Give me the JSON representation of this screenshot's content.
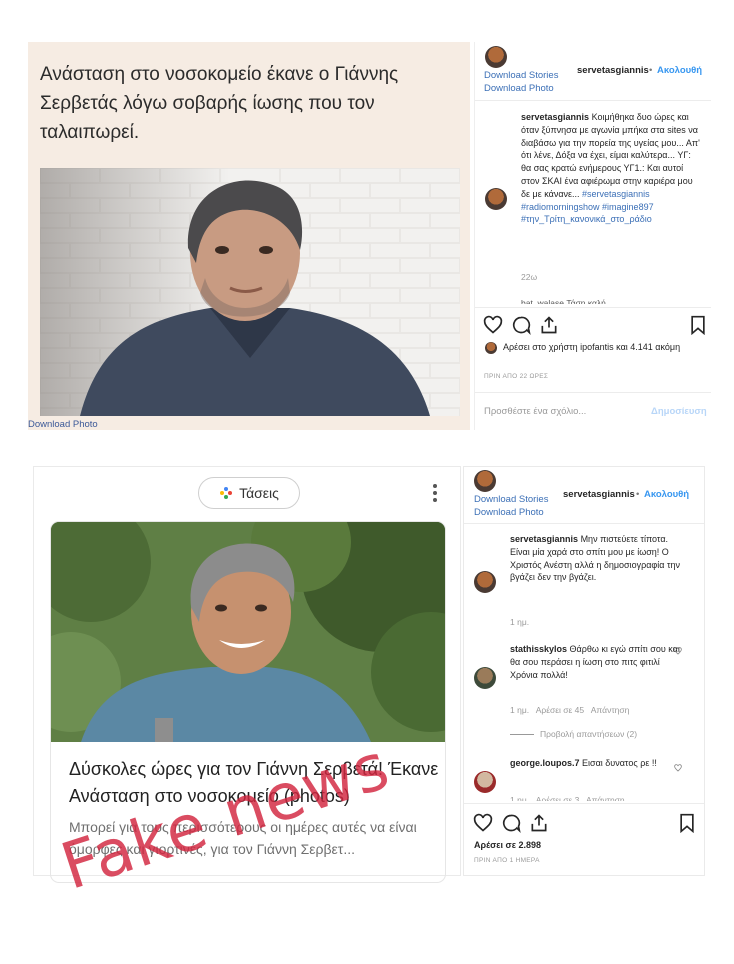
{
  "top": {
    "headline": "Ανάσταση στο νοσοκομείο έκανε ο Γιάννης Σερβετάς λόγω σοβαρής ίωσης που τον ταλαιπωρεί.",
    "download_photo_label": "Download Photo",
    "instagram": {
      "download_stories": "Download Stories",
      "download_photo": "Download Photo",
      "username": "servetasgiannis",
      "follow_sep": "•",
      "follow": "Ακολουθή",
      "caption_user": "servetasgiannis",
      "caption_text": "Κοιμήθηκα δυο ώρες και όταν ξύπνησα με αγωνία μπήκα στα sites να διαβάσω για την πορεία της υγείας μου... Απ' ότι λένε, Δόξα να έχει, είμαι καλύτερα... ΥΓ: θα σας κρατώ ενήμερους ΥΓ1.: Και αυτοί στον ΣΚΑΙ ένα αφιέρωμα στην καριέρα μου δε με κάνανε...",
      "hashtags": "#servetasgiannis #radiomorningshow #imagine897 #την_Τρίτη_κανονικά_στο_ράδιο",
      "caption_age": "22ω",
      "truncated_next": "bat_walase Τάση καλή",
      "liked_by": "Αρέσει στο χρήστη ipofantis και 4.141 ακόμη",
      "time_label": "ΠΡΙΝ ΑΠΟ 22 ΩΡΕΣ",
      "comment_placeholder": "Προσθέστε ένα σχόλιο...",
      "post_button": "Δημοσίευση"
    }
  },
  "bottom": {
    "trends_label": "Τάσεις",
    "card_title": "Δύσκολες ώρες για τον Γιάννη Σερβετά! Έκανε Ανάσταση στο νοσοκομείο (photos)",
    "card_snippet": "Μπορεί για τους περισσότερους οι ημέρες αυτές να είναι όμορφες και γιορτινές, για τον Γιάννη Σερβετ...",
    "stamp": "Fake news",
    "instagram": {
      "download_stories": "Download Stories",
      "download_photo": "Download Photo",
      "username": "servetasgiannis",
      "follow_sep": "•",
      "follow": "Ακολουθή",
      "comments": [
        {
          "user": "servetasgiannis",
          "text": "Μην πιστεύετε τίποτα. Είναι μία χαρά στο σπίτι μου με ίωση! Ο Χριστός Ανέστη αλλά η δημοσιογραφία την βγάζει δεν την βγάζει.",
          "meta": "1 ημ."
        },
        {
          "user": "stathisskylos",
          "text": "Θάρθω κι εγώ σπίτι σου και θα σου περάσει η ίωση στο πιτς φιτιλί Χρόνια πολλά!",
          "meta": "1 ημ.   Αρέσει σε 45   Απάντηση",
          "replies": "Προβολή απαντήσεων (2)"
        },
        {
          "user": "george.loupos.7",
          "text": "Εισαι δυνατος ρε !!",
          "meta": "1 ημ.   Αρέσει σε 3   Απάντηση"
        }
      ],
      "likes": "Αρέσει σε 2.898",
      "time_label": "ΠΡΙΝ ΑΠΟ 1 ΗΜΕΡΑ"
    }
  }
}
